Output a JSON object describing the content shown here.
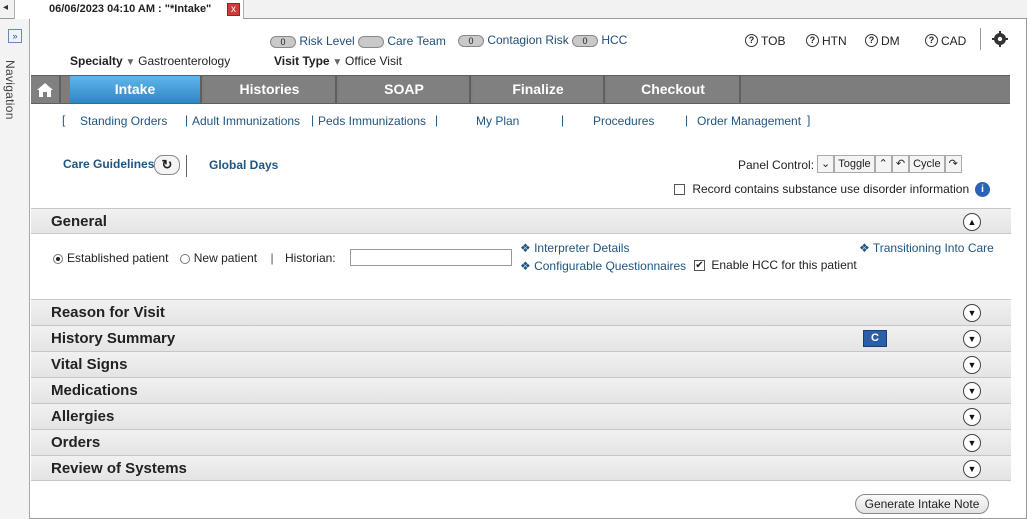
{
  "document_tab": {
    "title": "06/06/2023 04:10 AM : \"*Intake\"",
    "close_label": "x"
  },
  "navigation": {
    "expand_label": "»",
    "label": "Navigation"
  },
  "header": {
    "specialty_label": "Specialty",
    "specialty_value": "Gastroenterology",
    "visit_type_label": "Visit Type",
    "visit_type_value": "Office Visit",
    "indicators": [
      {
        "count": "0",
        "label": "Risk Level"
      },
      {
        "count": "",
        "label": "Care Team"
      },
      {
        "count": "0",
        "label": "Contagion Risk"
      },
      {
        "count": "0",
        "label": "HCC"
      }
    ],
    "conditions": [
      "TOB",
      "HTN",
      "DM",
      "CAD"
    ]
  },
  "tabs": [
    "Intake",
    "Histories",
    "SOAP",
    "Finalize",
    "Checkout"
  ],
  "subnav": [
    "Standing Orders",
    "Adult Immunizations",
    "Peds Immunizations",
    "My Plan",
    "Procedures",
    "Order Management"
  ],
  "toolbar": {
    "care_guidelines": "Care Guidelines",
    "global_days": "Global Days",
    "panel_control_label": "Panel Control:",
    "toggle_label": "Toggle",
    "cycle_label": "Cycle",
    "substance_use_label": "Record contains substance use disorder information"
  },
  "general": {
    "title": "General",
    "established_patient": "Established patient",
    "new_patient": "New patient",
    "historian_label": "Historian:",
    "historian_value": "",
    "interpreter_details": "Interpreter Details",
    "configurable_questionnaires": "Configurable Questionnaires",
    "enable_hcc": "Enable HCC for this patient",
    "transitioning_into_care": "Transitioning Into Care"
  },
  "sections": [
    "Reason for Visit",
    "History Summary",
    "Vital Signs",
    "Medications",
    "Allergies",
    "Orders",
    "Review of Systems"
  ],
  "footer": {
    "generate_button": "Generate Intake Note"
  }
}
